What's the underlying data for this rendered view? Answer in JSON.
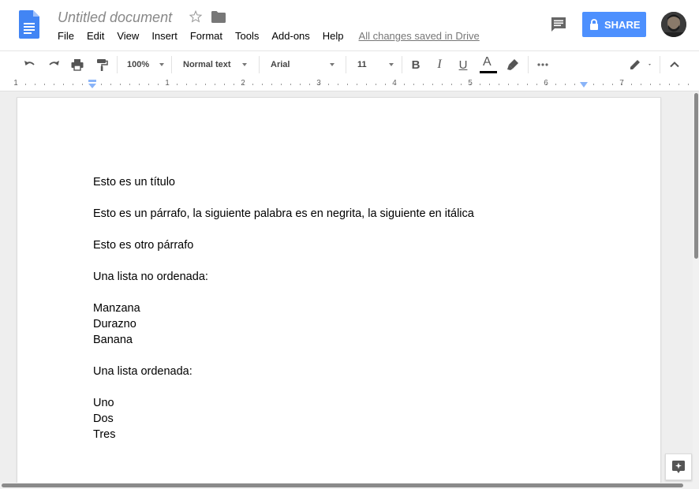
{
  "doc_title": "Untitled document",
  "menu": [
    "File",
    "Edit",
    "View",
    "Insert",
    "Format",
    "Tools",
    "Add-ons",
    "Help"
  ],
  "save_status": "All changes saved in Drive",
  "share_label": "SHARE",
  "accent_color": "#4d90fe",
  "toolbar": {
    "zoom": "100%",
    "style": "Normal text",
    "font": "Arial",
    "font_size": "11",
    "bold": "B",
    "italic": "I",
    "underline": "U",
    "text_color": "A"
  },
  "ruler_numbers": [
    "1",
    "1",
    "2",
    "3",
    "4",
    "5",
    "6",
    "7"
  ],
  "document": {
    "title_line": "Esto es un título",
    "paragraph1": "Esto es un párrafo, la siguiente palabra es en negrita, la siguiente en itálica",
    "paragraph2": "Esto es otro párrafo",
    "unordered_label": "Una lista no ordenada:",
    "unordered_items": [
      "Manzana",
      "Durazno",
      "Banana"
    ],
    "ordered_label": "Una lista ordenada:",
    "ordered_items": [
      "Uno",
      "Dos",
      "Tres"
    ]
  }
}
